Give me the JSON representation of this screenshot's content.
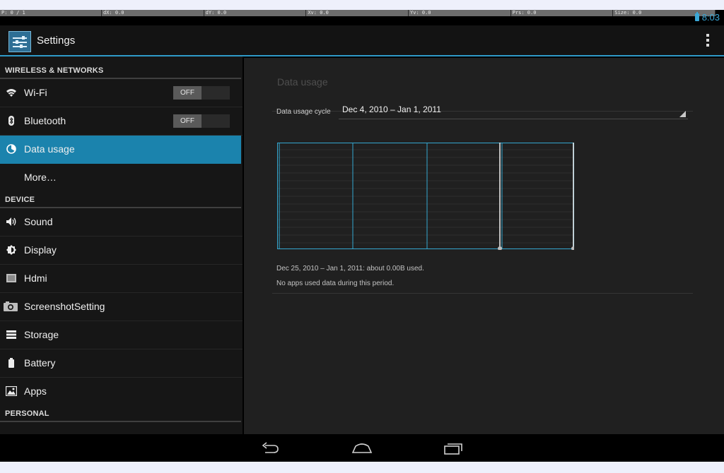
{
  "status_bar": {
    "pointer": "P: 0 / 1",
    "dx": "dX: 0.0",
    "dy": "dY: 0.0",
    "xv": "Xv: 0.0",
    "yv": "Yv: 0.0",
    "prs": "Prs: 0.0",
    "size": "Size: 0.0",
    "clock": "8:03",
    "accent": "#33b5e5"
  },
  "action_bar": {
    "title": "Settings"
  },
  "sidebar": {
    "sections": [
      {
        "header": "WIRELESS & NETWORKS",
        "items": [
          {
            "label": "Wi-Fi",
            "icon": "wifi-icon",
            "toggle": "OFF"
          },
          {
            "label": "Bluetooth",
            "icon": "bluetooth-icon",
            "toggle": "OFF"
          },
          {
            "label": "Data usage",
            "icon": "data-usage-icon",
            "selected": true
          },
          {
            "label": "More…",
            "icon": ""
          }
        ]
      },
      {
        "header": "DEVICE",
        "items": [
          {
            "label": "Sound",
            "icon": "speaker-icon"
          },
          {
            "label": "Display",
            "icon": "brightness-icon"
          },
          {
            "label": "Hdmi",
            "icon": "hdmi-icon"
          },
          {
            "label": "ScreenshotSetting",
            "icon": "camera-icon"
          },
          {
            "label": "Storage",
            "icon": "storage-icon"
          },
          {
            "label": "Battery",
            "icon": "battery-icon"
          },
          {
            "label": "Apps",
            "icon": "apps-icon"
          }
        ]
      },
      {
        "header": "PERSONAL",
        "items": []
      }
    ],
    "selected_color": "#1b83ad"
  },
  "detail": {
    "title": "Data usage",
    "cycle_label": "Data usage cycle",
    "cycle_value": "Dec 4, 2010 – Jan 1, 2011",
    "summary": "Dec 25, 2010 – Jan 1, 2011: about 0.00B used.",
    "no_apps": "No apps used data during this period."
  }
}
